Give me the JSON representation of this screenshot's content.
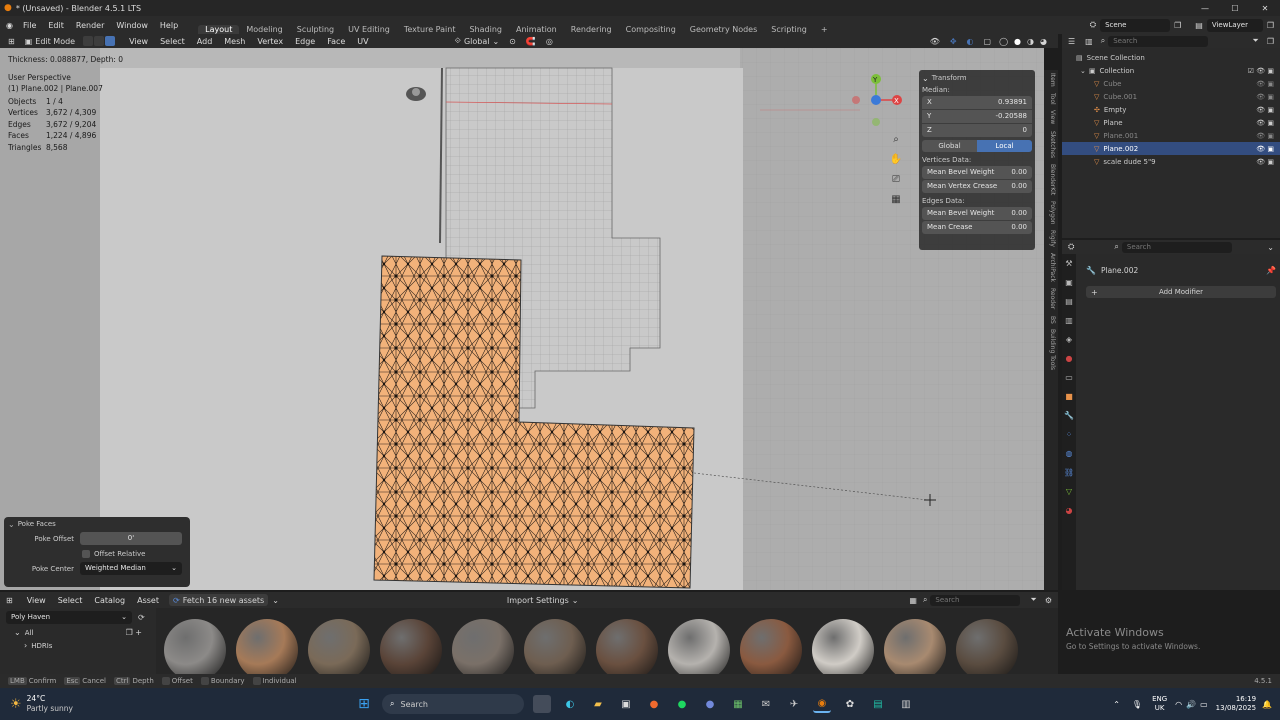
{
  "window": {
    "title": "* (Unsaved) - Blender 4.5.1 LTS"
  },
  "menu": [
    "File",
    "Edit",
    "Render",
    "Window",
    "Help"
  ],
  "workspaces": [
    "Layout",
    "Modeling",
    "Sculpting",
    "UV Editing",
    "Texture Paint",
    "Shading",
    "Animation",
    "Rendering",
    "Compositing",
    "Geometry Nodes",
    "Scripting"
  ],
  "active_workspace": "Layout",
  "scene": {
    "name": "Scene",
    "view_layer": "ViewLayer"
  },
  "viewport_header": {
    "mode": "Edit Mode",
    "menus": [
      "View",
      "Select",
      "Add",
      "Mesh",
      "Vertex",
      "Edge",
      "Face",
      "UV"
    ],
    "orientation": "Global"
  },
  "overlay_info": {
    "op_status": "Thickness: 0.088877, Depth: 0",
    "view": "User Perspective",
    "object": "(1) Plane.002 | Plane.007",
    "stats": [
      {
        "label": "Objects",
        "value": "1 / 4"
      },
      {
        "label": "Vertices",
        "value": "3,672 / 4,309"
      },
      {
        "label": "Edges",
        "value": "3,672 / 9,204"
      },
      {
        "label": "Faces",
        "value": "1,224 / 4,896"
      },
      {
        "label": "Triangles",
        "value": "8,568"
      }
    ]
  },
  "transform_panel": {
    "title": "Transform",
    "median_label": "Median:",
    "x_label": "X",
    "x_value": "0.93891",
    "y_label": "Y",
    "y_value": "-0.20588",
    "z_label": "Z",
    "z_value": "0",
    "global_label": "Global",
    "local_label": "Local",
    "vertices_data": "Vertices Data:",
    "mean_bevel_weight_label": "Mean Bevel Weight",
    "mean_bevel_weight": "0.00",
    "mean_vertex_crease_label": "Mean Vertex Crease",
    "mean_vertex_crease": "0.00",
    "edges_data": "Edges Data:",
    "edge_bevel_weight_label": "Mean Bevel Weight",
    "edge_bevel_weight": "0.00",
    "mean_crease_label": "Mean Crease",
    "mean_crease": "0.00"
  },
  "side_tabs": [
    "Item",
    "Tool",
    "View",
    "Sketches",
    "BlenderKit",
    "Polygon",
    "Rigify",
    "ArchiPack",
    "Reoder",
    "BS",
    "Building Tools"
  ],
  "operator_panel": {
    "title": "Poke Faces",
    "offset_label": "Poke Offset",
    "offset_value": "0'",
    "relative_label": "Offset Relative",
    "center_label": "Poke Center",
    "center_value": "Weighted Median"
  },
  "outliner": {
    "search_placeholder": "Search",
    "root": "Scene Collection",
    "collection": "Collection",
    "items": [
      "Cube",
      "Cube.001",
      "Empty",
      "Plane",
      "Plane.001",
      "Plane.002",
      "scale dude 5\"9"
    ],
    "selected": "Plane.002"
  },
  "properties": {
    "search_placeholder": "Search",
    "object": "Plane.002",
    "add_modifier": "Add Modifier"
  },
  "asset_browser": {
    "menus": [
      "View",
      "Select",
      "Catalog",
      "Asset"
    ],
    "fetch": "Fetch 16 new assets",
    "import_settings": "Import Settings",
    "library": "Poly Haven",
    "search_placeholder": "Search",
    "tree": [
      "All",
      "HDRIs"
    ],
    "materials": [
      {
        "color": "#8c8a88"
      },
      {
        "color": "#a67a58"
      },
      {
        "color": "#7a6a58"
      },
      {
        "color": "#5a4438"
      },
      {
        "color": "#7a7068"
      },
      {
        "color": "#6e5e50"
      },
      {
        "color": "#6a5040"
      },
      {
        "color": "#b5b2ae"
      },
      {
        "color": "#8a5a40"
      },
      {
        "color": "#d0ccc6"
      },
      {
        "color": "#a88a70"
      },
      {
        "color": "#5a4c40"
      }
    ]
  },
  "statusbar": {
    "items": [
      "Confirm",
      "Cancel",
      "Depth",
      "Offset",
      "Boundary",
      "Individual"
    ],
    "keys": [
      "LMB",
      "Esc",
      "Ctrl",
      "",
      "",
      ""
    ],
    "version": "4.5.1"
  },
  "watermark": {
    "title": "Activate Windows",
    "subtitle": "Go to Settings to activate Windows."
  },
  "taskbar": {
    "weather_temp": "24°C",
    "weather_desc": "Partly sunny",
    "search_placeholder": "Search",
    "lang": "ENG",
    "region": "UK",
    "time": "16:19",
    "date": "13/08/2025"
  },
  "colors": {
    "accent": "#4772b3",
    "mesh_face": "#f0b07a",
    "viewport_bg": "#b8b8b8",
    "selected_row": "#334d80"
  }
}
